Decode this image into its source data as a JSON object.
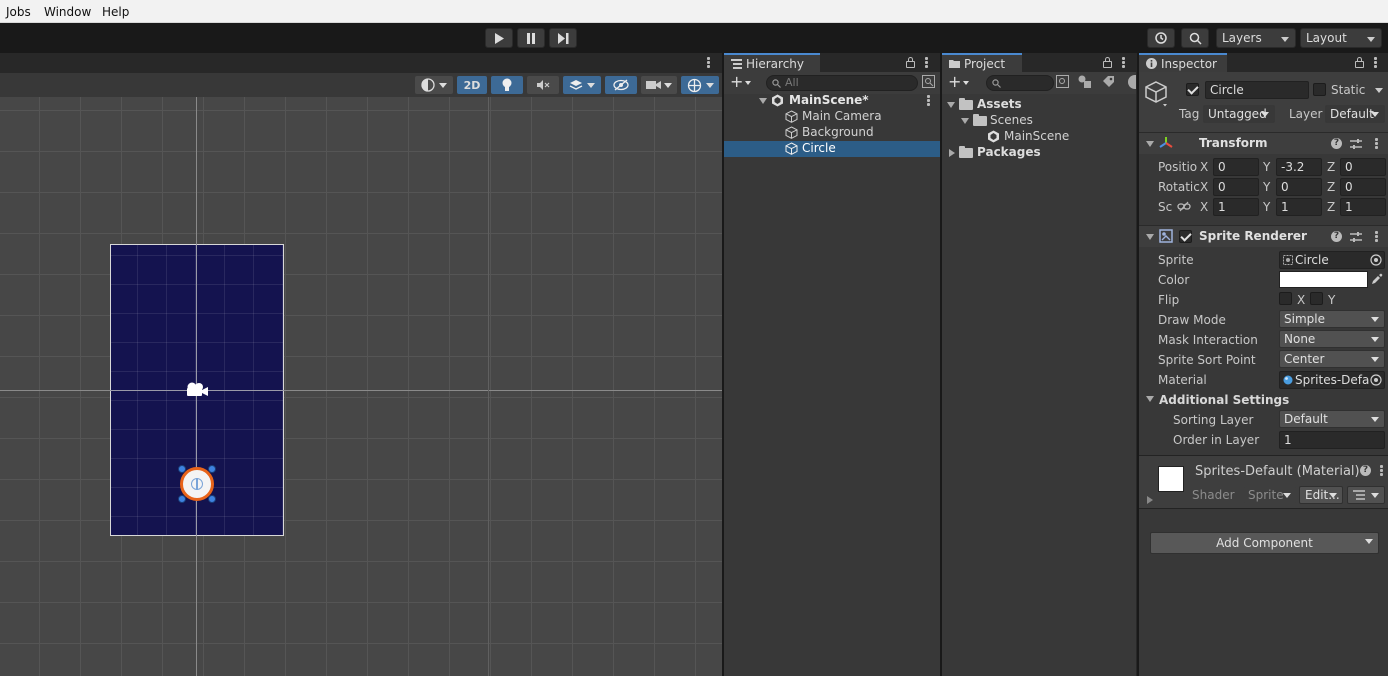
{
  "menu": {
    "items": [
      "Jobs",
      "Window",
      "Help"
    ]
  },
  "toolbar": {
    "layers_label": "Layers",
    "layout_label": "Layout"
  },
  "scene": {
    "mode_2d_label": "2D"
  },
  "hierarchy": {
    "tab_label": "Hierarchy",
    "search_placeholder": "All",
    "scene_name": "MainScene*",
    "objects": [
      "Main Camera",
      "Background",
      "Circle"
    ],
    "selected": "Circle"
  },
  "project": {
    "tab_label": "Project",
    "tree": {
      "assets": "Assets",
      "scenes": "Scenes",
      "main_scene": "MainScene",
      "packages": "Packages"
    }
  },
  "inspector": {
    "tab_label": "Inspector",
    "object_name": "Circle",
    "static_label": "Static",
    "tag_label": "Tag",
    "tag_value": "Untagged",
    "layer_label": "Layer",
    "layer_value": "Default",
    "transform": {
      "title": "Transform",
      "position_label": "Positio",
      "rotation_label": "Rotatic",
      "scale_label": "Sc",
      "axis_x": "X",
      "axis_y": "Y",
      "axis_z": "Z",
      "position": [
        "0",
        "-3.2",
        "0"
      ],
      "rotation": [
        "0",
        "0",
        "0"
      ],
      "scale": [
        "1",
        "1",
        "1"
      ]
    },
    "sprite_renderer": {
      "title": "Sprite Renderer",
      "sprite_label": "Sprite",
      "sprite_value": "Circle",
      "color_label": "Color",
      "color_value": "#ffffff",
      "flip_label": "Flip",
      "flip_x": "X",
      "flip_y": "Y",
      "draw_mode_label": "Draw Mode",
      "draw_mode_value": "Simple",
      "mask_label": "Mask Interaction",
      "mask_value": "None",
      "sort_point_label": "Sprite Sort Point",
      "sort_point_value": "Center",
      "material_label": "Material",
      "material_value": "Sprites-Defa",
      "additional_label": "Additional Settings",
      "sorting_layer_label": "Sorting Layer",
      "sorting_layer_value": "Default",
      "order_label": "Order in Layer",
      "order_value": "1"
    },
    "material": {
      "title": "Sprites-Default (Material)",
      "shader_label": "Shader",
      "shader_value": "Sprite",
      "edit_label": "Edit..."
    },
    "add_component_label": "Add Component"
  },
  "colors": {
    "accent": "#4a89d0",
    "selection": "#2c5d87",
    "camera_bg": "#14134f"
  }
}
